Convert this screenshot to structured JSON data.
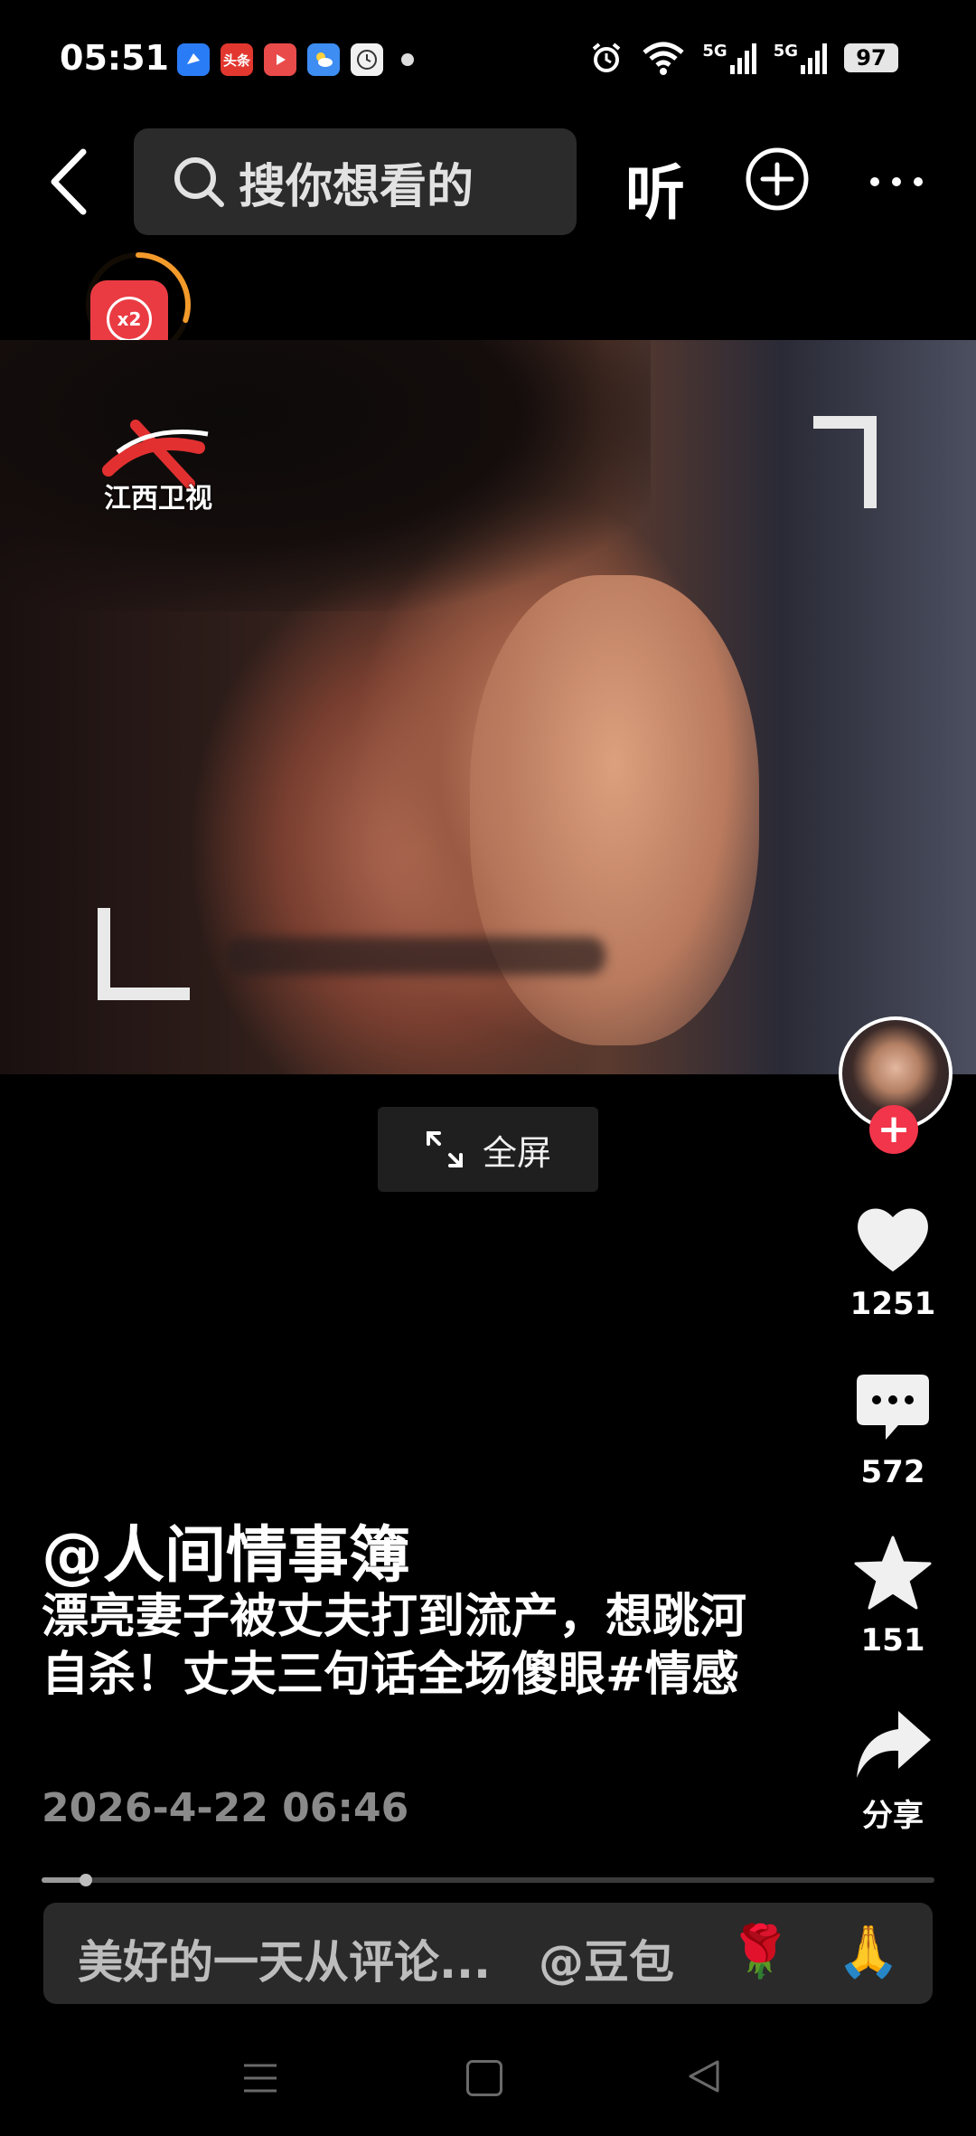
{
  "status_bar": {
    "time": "05:51",
    "apps": [
      {
        "icon": "blue-app-icon",
        "color": "#2a7cf6",
        "label": ""
      },
      {
        "icon": "toutiao-icon",
        "color": "#e2372f",
        "label": "头条"
      },
      {
        "icon": "video-app-icon",
        "color": "#e94b4b",
        "label": ""
      },
      {
        "icon": "weather-icon",
        "color": "#3d8df3",
        "label": ""
      },
      {
        "icon": "clock-app-icon",
        "color": "#f1f1f1",
        "label": ""
      }
    ],
    "network_5g_a": "5G",
    "network_5g_b": "5G",
    "battery": "97"
  },
  "top_bar": {
    "search_placeholder": "搜你想看的",
    "listen_label": "听"
  },
  "red_packet": {
    "label": "x2",
    "progress": 0.3
  },
  "video": {
    "channel_logo_text": "江西卫视",
    "fullscreen_label": "全屏"
  },
  "side_actions": {
    "like_count": "1251",
    "comment_count": "572",
    "favorite_count": "151",
    "share_label": "分享",
    "follow_label": "+"
  },
  "post": {
    "author": "@人间情事簿",
    "description": "漂亮妻子被丈夫打到流产，想跳河自杀！丈夫三句话全场傻眼",
    "hashtag": "#情感",
    "date": "2026-4-22 06:46",
    "playback_progress": 0.05
  },
  "comment_bar": {
    "placeholder": "美好的一天从评论...",
    "mention": "@豆包",
    "emoji_1": "🌹",
    "emoji_2": "🙏"
  },
  "colors": {
    "background": "#000000",
    "accent_red": "#f2354a",
    "ring_orange": "#f39a2b"
  }
}
